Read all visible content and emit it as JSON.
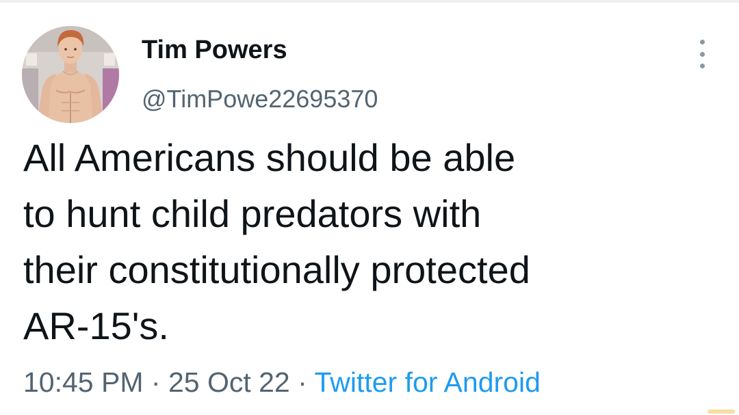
{
  "tweet": {
    "author": {
      "display_name": "Tim Powers",
      "handle": "@TimPowe22695370"
    },
    "text_lines": [
      "All Americans should be able",
      "to hunt child predators with",
      "their constitutionally protected",
      "AR-15's."
    ],
    "time": "10:45 PM",
    "separator": "·",
    "date": "25 Oct 22",
    "source": "Twitter for Android"
  },
  "icons": {
    "more_options": "more-options-icon",
    "avatar": "profile-avatar"
  },
  "colors": {
    "text_primary": "#0f1419",
    "text_secondary": "#536471",
    "link": "#1d9bf0"
  }
}
